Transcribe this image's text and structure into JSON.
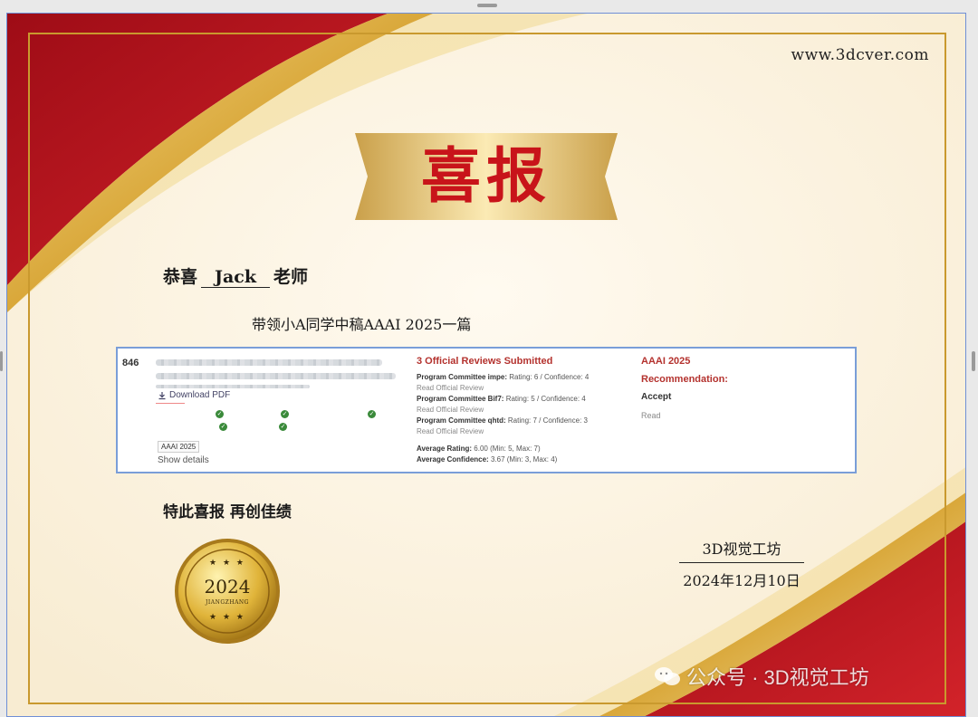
{
  "certificate": {
    "site_url": "www.3dcver.com",
    "banner_title": "喜报",
    "congrats_prefix": "恭喜",
    "honoree_name": "Jack",
    "congrats_suffix": "老师",
    "achievement": "带领小A同学中稿AAAI 2025一篇",
    "closing": "特此喜报 再创佳绩",
    "organization": "3D视觉工坊",
    "date": "2024年12月10日",
    "seal": {
      "year": "2024",
      "city": "JIANGZHANG",
      "stars_top": "★ ★ ★",
      "stars_bot": "★ ★ ★"
    },
    "watermark": "公众号 · 3D视觉工坊"
  },
  "review_card": {
    "paper_number": "846",
    "download_label": "Download PDF",
    "venue_tag": "AAAI 2025",
    "show_details": "Show details",
    "reviews_header": "3 Official Reviews Submitted",
    "reviews": [
      {
        "committee": "Program Committee impe:",
        "detail": "Rating: 6 / Confidence: 4",
        "link": "Read Official Review"
      },
      {
        "committee": "Program Committee Bif7:",
        "detail": "Rating: 5 / Confidence: 4",
        "link": "Read Official Review"
      },
      {
        "committee": "Program Committee qhtd:",
        "detail": "Rating: 7 / Confidence: 3",
        "link": "Read Official Review"
      }
    ],
    "average_rating_label": "Average Rating:",
    "average_rating_value": "6.00 (Min: 5, Max: 7)",
    "average_confidence_label": "Average Confidence:",
    "average_confidence_value": "3.67 (Min: 3, Max: 4)",
    "decision_venue": "AAAI 2025",
    "recommendation_label": "Recommendation:",
    "decision": "Accept",
    "read_label": "Read"
  },
  "colors": {
    "red": "#b5101a",
    "gold": "#d9a739",
    "cream": "#fbf3e0"
  },
  "icons": [
    "download-icon",
    "check-icon",
    "wechat-icon"
  ]
}
